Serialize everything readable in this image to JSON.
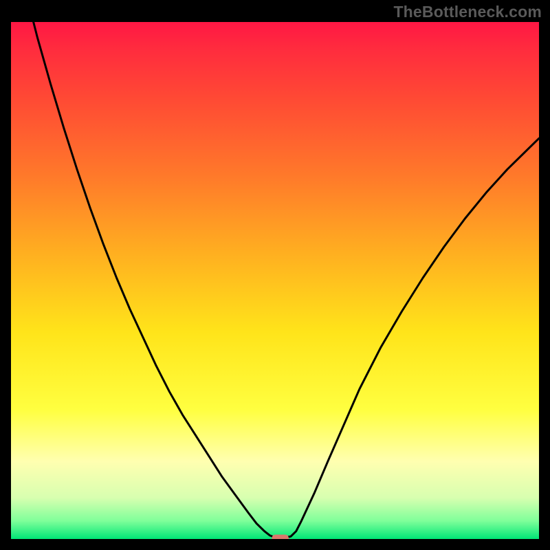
{
  "watermark": "TheBottleneck.com",
  "chart_data": {
    "type": "line",
    "title": "",
    "xlabel": "",
    "ylabel": "",
    "xlim": [
      0,
      100
    ],
    "ylim": [
      0,
      100
    ],
    "legend": false,
    "grid": false,
    "background_gradient_stops": [
      {
        "offset": 0.0,
        "color": "#ff1744"
      },
      {
        "offset": 0.05,
        "color": "#ff2b3e"
      },
      {
        "offset": 0.15,
        "color": "#ff4a34"
      },
      {
        "offset": 0.3,
        "color": "#ff7a2a"
      },
      {
        "offset": 0.45,
        "color": "#ffb020"
      },
      {
        "offset": 0.6,
        "color": "#ffe41a"
      },
      {
        "offset": 0.75,
        "color": "#ffff40"
      },
      {
        "offset": 0.85,
        "color": "#ffffb0"
      },
      {
        "offset": 0.92,
        "color": "#d8ffb0"
      },
      {
        "offset": 0.965,
        "color": "#7fff9a"
      },
      {
        "offset": 1.0,
        "color": "#00e676"
      }
    ],
    "series": [
      {
        "name": "bottleneck-curve",
        "stroke": "#000000",
        "stroke_width": 3,
        "x": [
          0.0,
          2.5,
          5.0,
          7.5,
          10.0,
          12.5,
          15.0,
          17.5,
          20.0,
          22.5,
          25.0,
          27.5,
          30.0,
          32.5,
          35.0,
          37.5,
          40.0,
          42.5,
          45.0,
          46.5,
          48.0,
          49.0,
          50.0,
          51.0,
          52.0,
          53.0,
          54.0,
          55.0,
          57.5,
          60.0,
          63.0,
          66.0,
          70.0,
          74.0,
          78.0,
          82.0,
          86.0,
          90.0,
          94.0,
          98.0,
          100.0
        ],
        "y": [
          118.0,
          107.0,
          97.0,
          88.0,
          79.5,
          71.5,
          64.0,
          57.0,
          50.5,
          44.5,
          39.0,
          33.5,
          28.5,
          24.0,
          20.0,
          16.0,
          12.0,
          8.5,
          5.0,
          3.0,
          1.5,
          0.7,
          0.3,
          0.3,
          0.3,
          0.5,
          1.5,
          3.5,
          9.0,
          15.0,
          22.0,
          29.0,
          37.0,
          44.0,
          50.5,
          56.5,
          62.0,
          67.0,
          71.5,
          75.5,
          77.5
        ]
      }
    ],
    "marker": {
      "name": "optimum-marker",
      "shape": "rounded-rect",
      "color": "#d9776b",
      "x": 51.0,
      "y": 0.0,
      "width_x": 3.2,
      "height_y": 1.7
    }
  }
}
